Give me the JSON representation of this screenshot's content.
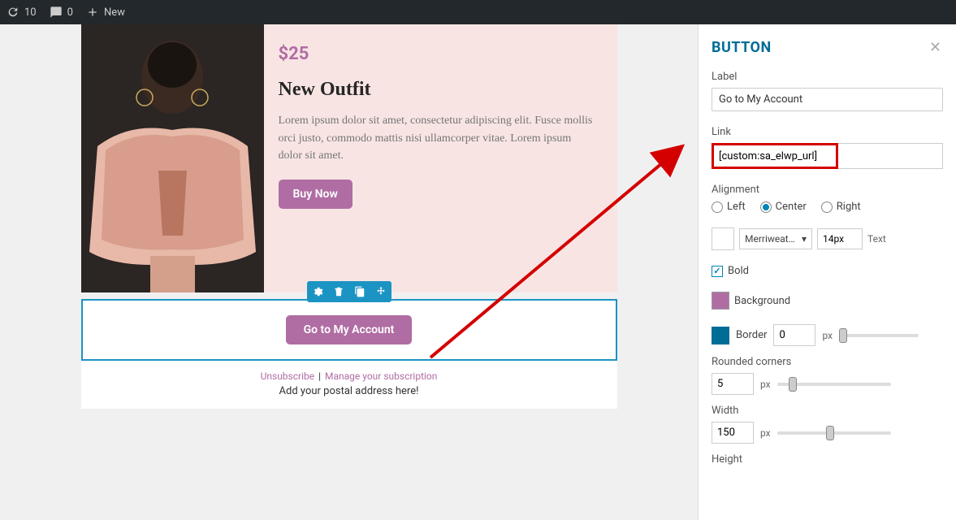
{
  "topbar": {
    "refresh_count": "10",
    "comments_count": "0",
    "new_label": "New"
  },
  "product": {
    "price": "$25",
    "title": "New Outfit",
    "description": "Lorem ipsum dolor sit amet, consectetur adipiscing elit. Fusce mollis orci justo, commodo mattis nisi ullamcorper vitae. Lorem ipsum dolor sit amet.",
    "buy_label": "Buy Now"
  },
  "account_button": {
    "label": "Go to My Account"
  },
  "footer": {
    "unsubscribe": "Unsubscribe",
    "manage": "Manage your subscription",
    "sep": "|",
    "postal": "Add your postal address here!"
  },
  "sidebar": {
    "title": "BUTTON",
    "label_field": "Label",
    "label_value": "Go to My Account",
    "link_field": "Link",
    "link_value": "[custom:sa_elwp_url]",
    "alignment_label": "Alignment",
    "align_left": "Left",
    "align_center": "Center",
    "align_right": "Right",
    "font_family": "Merriweat…",
    "font_size": "14px",
    "text_label": "Text",
    "bold_label": "Bold",
    "background_label": "Background",
    "border_label": "Border",
    "border_value": "0",
    "px_label": "px",
    "rounded_label": "Rounded corners",
    "rounded_value": "5",
    "width_label": "Width",
    "width_value": "150",
    "height_label": "Height"
  }
}
